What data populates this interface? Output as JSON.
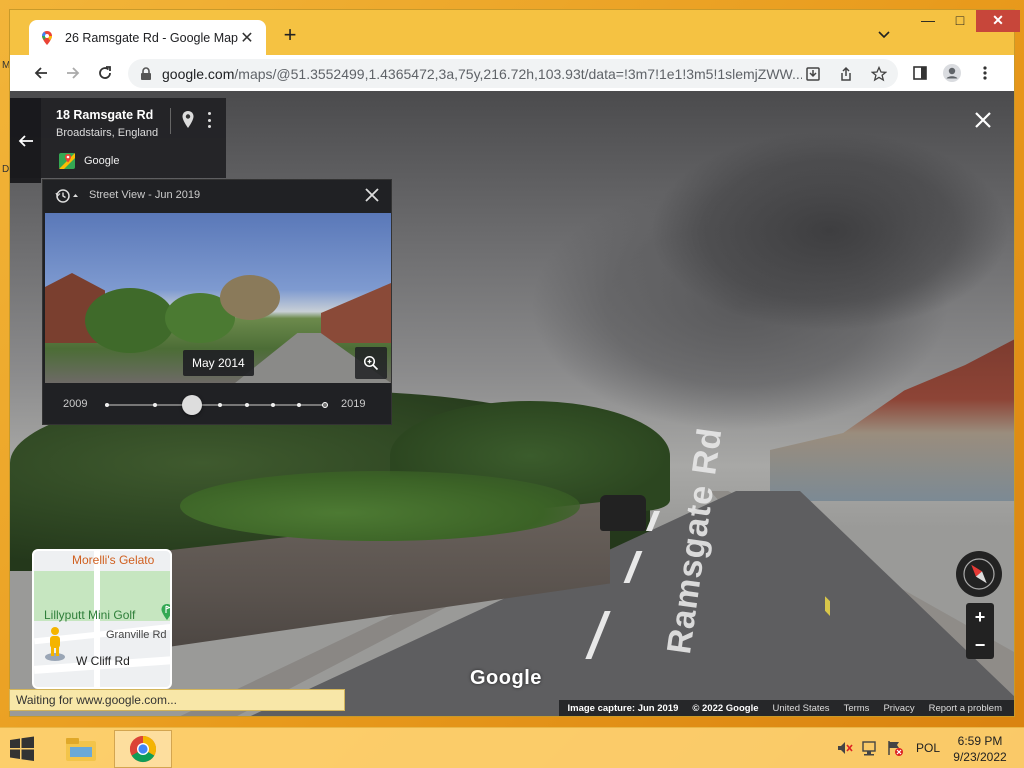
{
  "browser": {
    "tab_title": "26 Ramsgate Rd - Google Maps",
    "url_host": "google.com",
    "url_path": "/maps/@51.3552499,1.4365472,3a,75y,216.72h,103.93t/data=!3m7!1e1!3m5!1slemjZWW...",
    "status_text": "Waiting for www.google.com..."
  },
  "address_card": {
    "title": "18 Ramsgate Rd",
    "subtitle": "Broadstairs, England",
    "source": "Google"
  },
  "time_travel": {
    "header_label": "Street View - Jun 2019",
    "selected_date": "May 2014",
    "start_year": "2009",
    "end_year": "2019",
    "selected_fraction": 0.4
  },
  "minimap": {
    "place_gelato": "Morelli's Gelato",
    "place_golf": "Lillyputt Mini Golf",
    "road_granville": "Granville Rd",
    "road_wcliff": "W Cliff Rd"
  },
  "scene": {
    "road_text": "Ramsgate Rd",
    "logo": "Google"
  },
  "zoom": {
    "plus": "+",
    "minus": "−"
  },
  "footer": {
    "capture": "Image capture: Jun 2019",
    "copyright": "© 2022 Google",
    "region": "United States",
    "terms": "Terms",
    "privacy": "Privacy",
    "report": "Report a problem"
  },
  "taskbar": {
    "language": "POL",
    "time": "6:59 PM",
    "date": "9/23/2022"
  },
  "desktop": {
    "label_m": "M",
    "label_d": "D"
  },
  "colors": {
    "desktop": "#f2b53a",
    "chrome_frame": "#f5c242",
    "panel_dark": "#202124",
    "close_red": "#c7463a"
  }
}
